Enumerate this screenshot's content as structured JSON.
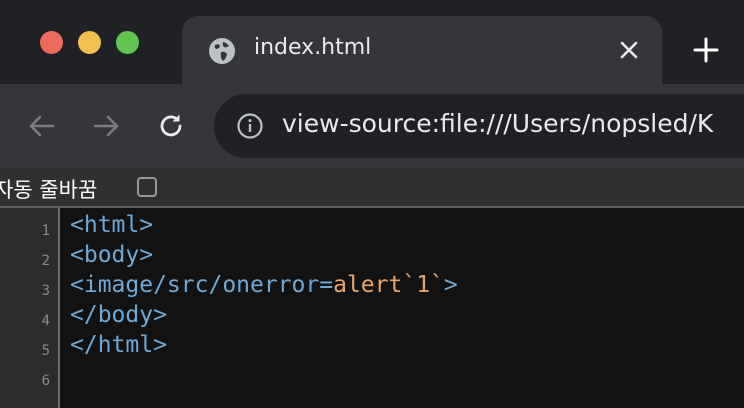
{
  "tab": {
    "title": "index.html"
  },
  "toolbar": {
    "url": "view-source:file:///Users/nopsled/K"
  },
  "line_wrap": {
    "label": "자동 줄바꿈",
    "checked": false
  },
  "source": {
    "line_numbers": [
      "1",
      "2",
      "3",
      "4",
      "5",
      "6"
    ],
    "lines": [
      {
        "tag": "<html>"
      },
      {
        "tag": "<body>"
      },
      {
        "tag_open": "<image/src/onerror=",
        "value": "alert`1`",
        "tag_close": ">"
      },
      {
        "tag": "</body>"
      },
      {
        "tag": "</html>"
      },
      {
        "tag": ""
      }
    ]
  },
  "colors": {
    "tag": "#6ea8d6",
    "attribute_value": "#e8a36a",
    "background": "#121212"
  },
  "icons": [
    "globe-icon",
    "close-icon",
    "plus-icon",
    "back-arrow-icon",
    "forward-arrow-icon",
    "reload-icon",
    "info-icon"
  ]
}
